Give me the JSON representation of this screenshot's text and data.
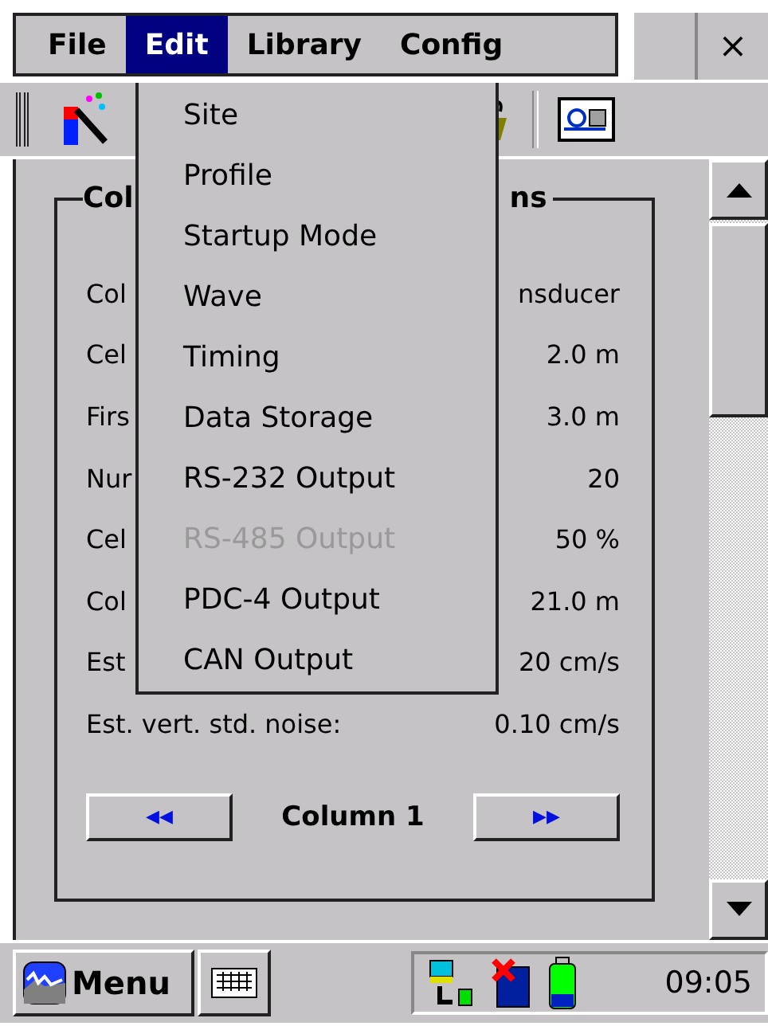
{
  "menu_bar": {
    "items": [
      {
        "label": "File",
        "selected": false
      },
      {
        "label": "Edit",
        "selected": true
      },
      {
        "label": "Library",
        "selected": false
      },
      {
        "label": "Config",
        "selected": false
      }
    ],
    "close": "×"
  },
  "dropdown": {
    "items": [
      {
        "label": "Site",
        "disabled": false
      },
      {
        "label": "Profile",
        "disabled": false
      },
      {
        "label": "Startup Mode",
        "disabled": false
      },
      {
        "label": "Wave",
        "disabled": false
      },
      {
        "label": "Timing",
        "disabled": false
      },
      {
        "label": "Data Storage",
        "disabled": false
      },
      {
        "label": "RS-232 Output",
        "disabled": false
      },
      {
        "label": "RS-485 Output",
        "disabled": true
      },
      {
        "label": "PDC-4 Output",
        "disabled": false
      },
      {
        "label": "CAN Output",
        "disabled": false
      }
    ]
  },
  "group": {
    "title_start": "Col",
    "title_end": "ns",
    "rows": [
      {
        "label": "Col",
        "value": "nsducer"
      },
      {
        "label": "Cel",
        "value": "2.0 m"
      },
      {
        "label": "Firs",
        "value": "3.0 m"
      },
      {
        "label": "Nur",
        "value": "20"
      },
      {
        "label": "Cel",
        "value": "50 %"
      },
      {
        "label": "Col",
        "value": "21.0 m"
      },
      {
        "label": "Est",
        "value": "20 cm/s"
      },
      {
        "label": "Est. vert. std. noise:",
        "value": "0.10 cm/s"
      }
    ],
    "prev": "◀◀",
    "column": "Column 1",
    "next": "▶▶"
  },
  "taskbar": {
    "start": "Menu",
    "time": "09:05"
  }
}
